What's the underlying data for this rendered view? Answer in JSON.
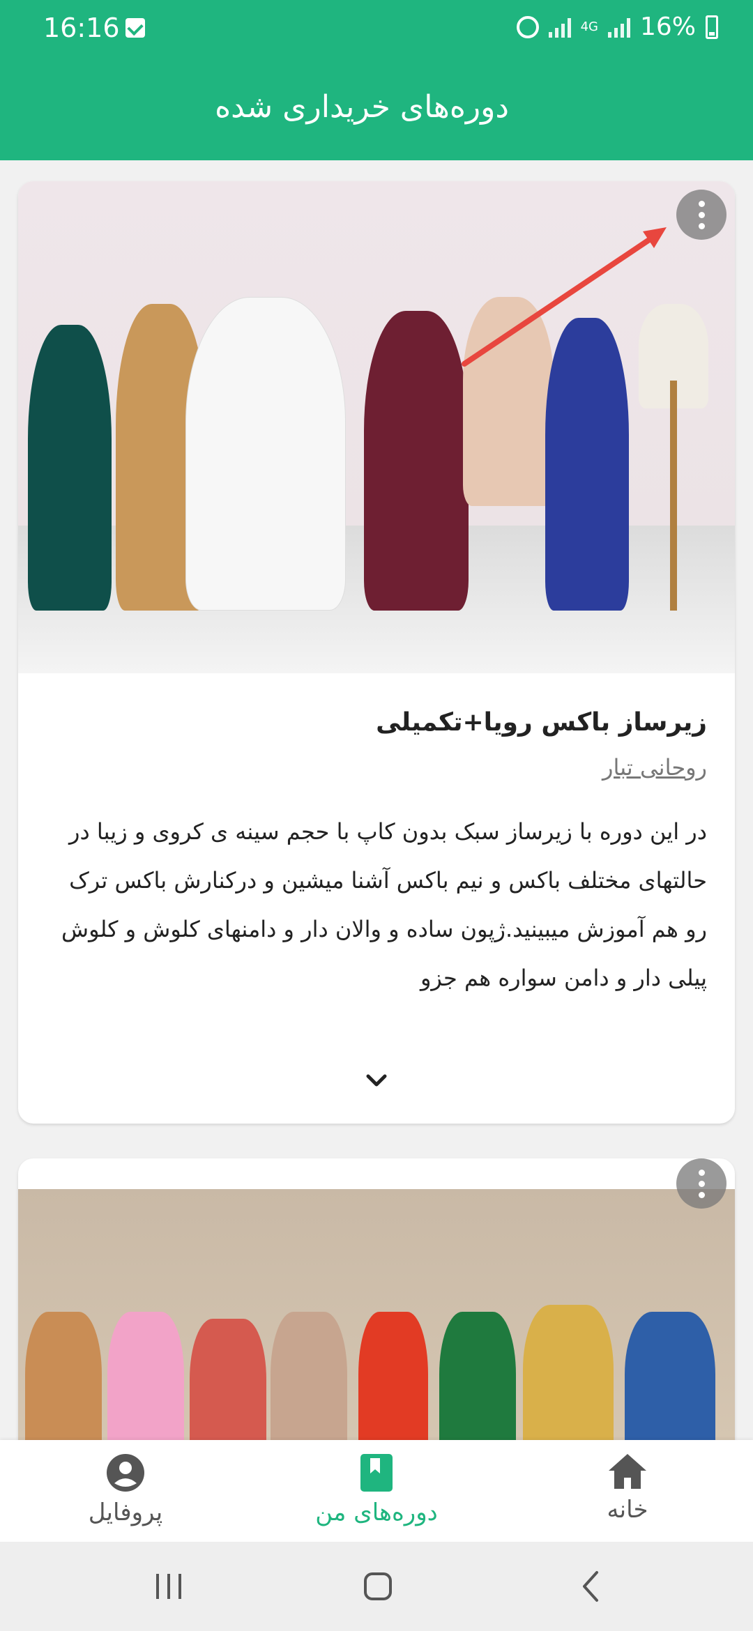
{
  "status": {
    "time": "16:16",
    "network": "4G",
    "battery": "16%"
  },
  "appbar": {
    "title": "دوره‌های خریداری شده"
  },
  "courses": [
    {
      "title": "زیرساز باکس رویا+تکمیلی",
      "author": "روحانی تبار",
      "description": "در این دوره با زیرساز سبک بدون کاپ با حجم سینه ی کروی و زیبا در حالتهای مختلف باکس و نیم باکس آشنا میشین و درکنارش باکس ترک رو هم آموزش میبینید.ژپون ساده و والان دار و دامنهای کلوش و کلوش پیلی دار و دامن سواره هم جزو"
    },
    {
      "title": "",
      "author": "",
      "description": ""
    }
  ],
  "bottom_nav": {
    "items": [
      {
        "label": "پروفایل",
        "icon": "profile-icon",
        "active": false
      },
      {
        "label": "دوره‌های من",
        "icon": "bookmark-book-icon",
        "active": true
      },
      {
        "label": "خانه",
        "icon": "home-icon",
        "active": false
      }
    ]
  },
  "colors": {
    "primary": "#1fb57f",
    "annotation_arrow": "#e8463e"
  }
}
